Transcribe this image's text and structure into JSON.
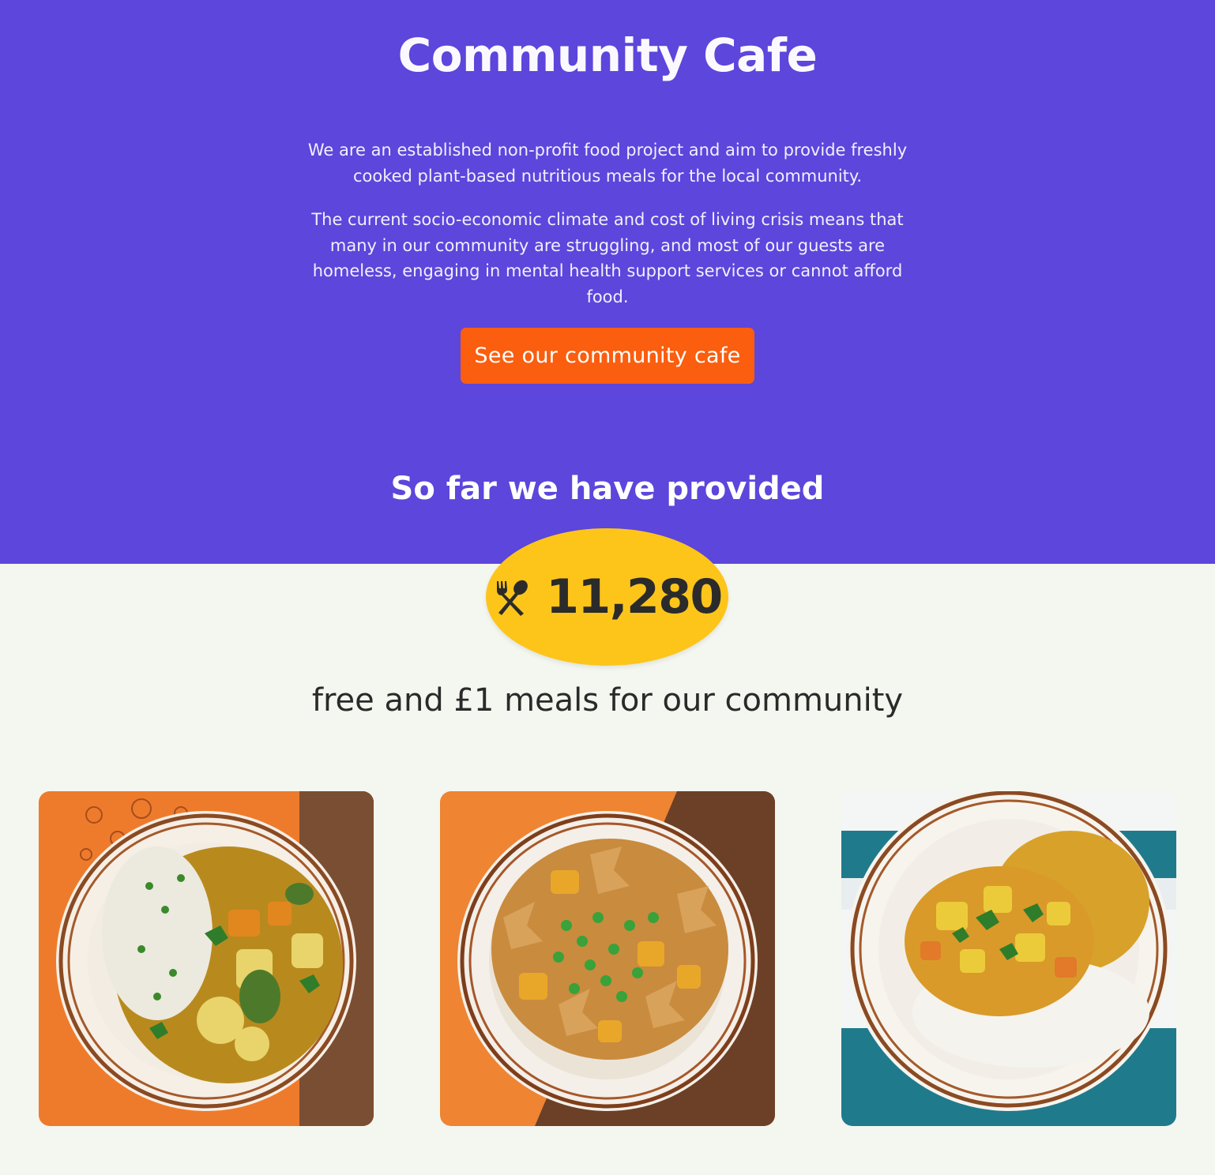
{
  "hero": {
    "title": "Community Cafe",
    "intro_1": "We are an established non-profit food project and aim to provide freshly cooked plant-based nutritious meals for the local community.",
    "intro_2": "The current socio-economic climate and cost of living crisis means that many in our community are struggling, and most of our guests are homeless, engaging in mental health support services or cannot afford food.",
    "cta_label": "See our community cafe",
    "background_color": "#5c46db",
    "cta_color": "#fa5e0e"
  },
  "stats": {
    "lead": "So far we have provided",
    "count": "11,280",
    "icon": "utensils-icon",
    "badge_color": "#fdc51a",
    "caption": "free and £1 meals for our community"
  },
  "gallery": [
    {
      "dish": "vegetable curry with rice and peas",
      "icon": "food-photo"
    },
    {
      "dish": "farfalle pasta with potatoes and peas",
      "icon": "food-photo"
    },
    {
      "dish": "vegetable curry with dal and rice",
      "icon": "food-photo"
    }
  ]
}
